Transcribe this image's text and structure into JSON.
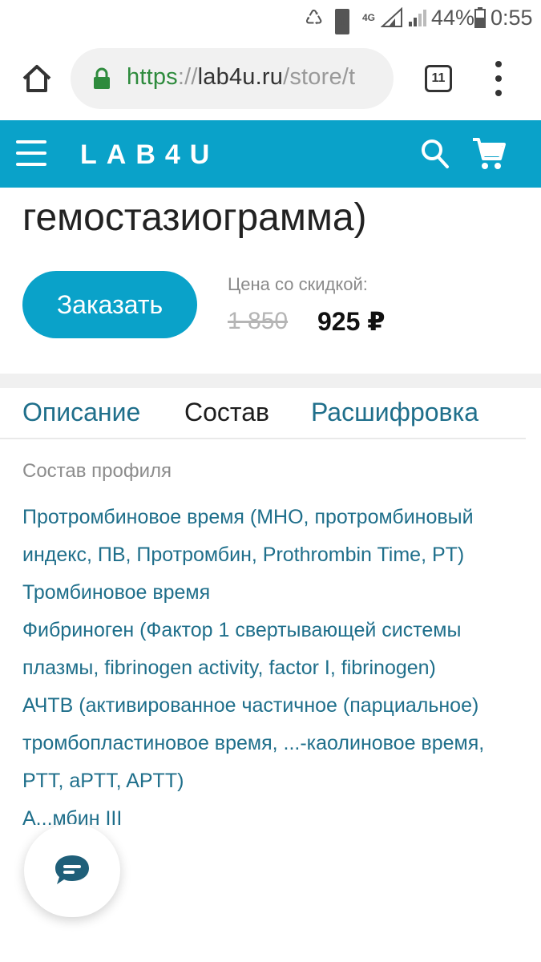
{
  "status_bar": {
    "battery": "44%",
    "time": "0:55",
    "network": "4G",
    "sim_badge": "1"
  },
  "browser": {
    "url_scheme": "https",
    "url_sep": "://",
    "url_host": "lab4u.ru",
    "url_path": "/store/t",
    "tab_count": "11"
  },
  "header": {
    "logo": "LAB4U"
  },
  "page": {
    "title": "гемостазиограмма)",
    "order_button": "Заказать",
    "price_label": "Цена со скидкой:",
    "old_price": "1 850",
    "new_price": "925 ₽"
  },
  "tabs": [
    {
      "label": "Описание",
      "active": false
    },
    {
      "label": "Состав",
      "active": true
    },
    {
      "label": "Расшифровка",
      "active": false
    }
  ],
  "composition": {
    "label": "Состав профиля",
    "items": [
      "Протромбиновое время (МНО, протромбиновый индекс, ПВ, Протромбин, Prothrombin Time, PT)",
      "Тромбиновое время",
      "Фибриноген (Фактор 1 свертывающей системы плазмы, fibrinogen activity, factor I, fibrinogen)",
      "АЧТВ (активированное частичное (парциальное) тромбопластиновое время, ...-каолиновое время, PTT, aPTT, APTT)",
      "А...мбин III"
    ]
  },
  "colors": {
    "brand": "#0aa2c9",
    "link": "#1f6f8b",
    "url_secure": "#2e8b3d"
  },
  "icons": {
    "home": "home-icon",
    "lock": "lock-icon",
    "menu": "hamburger-icon",
    "search": "search-icon",
    "cart": "cart-icon",
    "chat": "chat-icon"
  }
}
